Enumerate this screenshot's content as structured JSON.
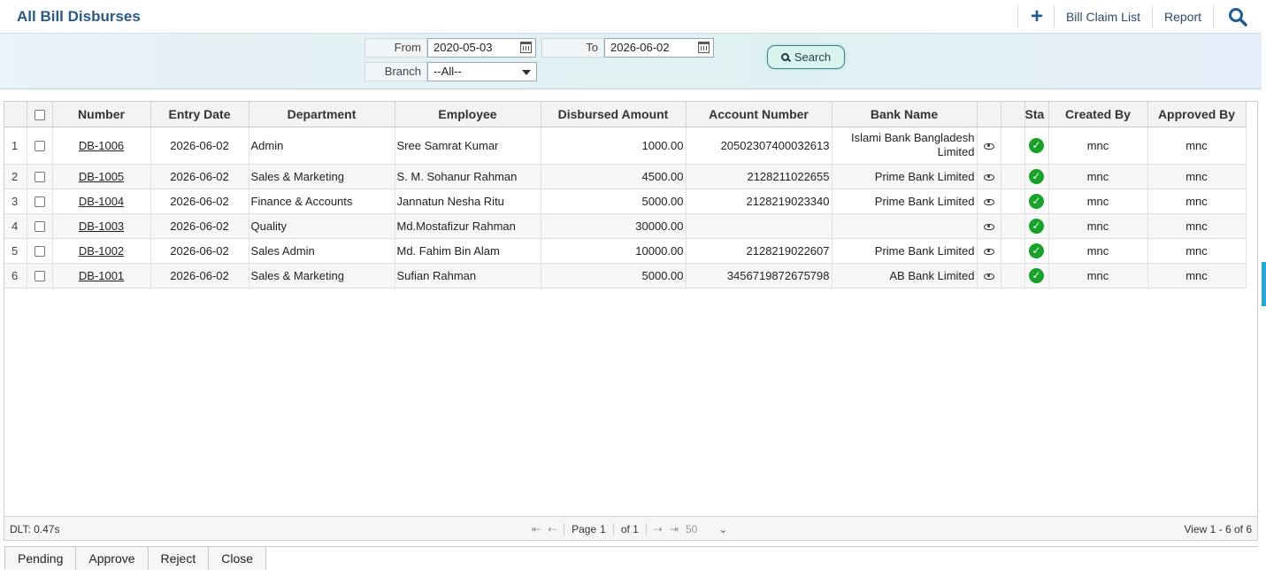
{
  "header": {
    "title": "All Bill Disburses",
    "actions": {
      "add_icon": "+",
      "bill_claim_list": "Bill Claim List",
      "report": "Report",
      "search_icon": "search-icon"
    }
  },
  "filter": {
    "from_label": "From",
    "from_value": "2020-05-03",
    "to_label": "To",
    "to_value": "2026-06-02",
    "branch_label": "Branch",
    "branch_value": "--All--",
    "search_label": "Search"
  },
  "table": {
    "columns": [
      "",
      "",
      "Number",
      "Entry Date",
      "Department",
      "Employee",
      "Disbursed Amount",
      "Account Number",
      "Bank Name",
      "",
      "",
      "Sta",
      "Created By",
      "Approved By"
    ],
    "rows": [
      {
        "idx": "1",
        "number": "DB-1006",
        "date": "2026-06-02",
        "department": "Admin",
        "employee": "Sree Samrat Kumar",
        "amount": "1000.00",
        "account": "20502307400032613",
        "bank": "Islami Bank Bangladesh Limited",
        "created_by": "mnc",
        "approved_by": "mnc"
      },
      {
        "idx": "2",
        "number": "DB-1005",
        "date": "2026-06-02",
        "department": "Sales & Marketing",
        "employee": "S. M. Sohanur Rahman",
        "amount": "4500.00",
        "account": "2128211022655",
        "bank": "Prime Bank Limited",
        "created_by": "mnc",
        "approved_by": "mnc"
      },
      {
        "idx": "3",
        "number": "DB-1004",
        "date": "2026-06-02",
        "department": "Finance & Accounts",
        "employee": "Jannatun Nesha Ritu",
        "amount": "5000.00",
        "account": "2128219023340",
        "bank": "Prime Bank Limited",
        "created_by": "mnc",
        "approved_by": "mnc"
      },
      {
        "idx": "4",
        "number": "DB-1003",
        "date": "2026-06-02",
        "department": "Quality",
        "employee": "Md.Mostafizur Rahman",
        "amount": "30000.00",
        "account": "",
        "bank": "",
        "created_by": "mnc",
        "approved_by": "mnc"
      },
      {
        "idx": "5",
        "number": "DB-1002",
        "date": "2026-06-02",
        "department": "Sales Admin",
        "employee": "Md. Fahim Bin Alam",
        "amount": "10000.00",
        "account": "2128219022607",
        "bank": "Prime Bank Limited",
        "created_by": "mnc",
        "approved_by": "mnc"
      },
      {
        "idx": "6",
        "number": "DB-1001",
        "date": "2026-06-02",
        "department": "Sales & Marketing",
        "employee": "Sufian Rahman",
        "amount": "5000.00",
        "account": "3456719872675798",
        "bank": "AB Bank Limited",
        "created_by": "mnc",
        "approved_by": "mnc"
      }
    ]
  },
  "pager": {
    "dlt": "DLT: 0.47s",
    "page_label": "Page",
    "page_value": "1",
    "of_label": "of 1",
    "page_size": "50",
    "view_info": "View 1 - 6 of 6"
  },
  "bottom": {
    "pending": "Pending",
    "approve": "Approve",
    "reject": "Reject",
    "close": "Close"
  },
  "colors": {
    "title": "#2a5a86",
    "status_ok": "#17a22a",
    "scroll_accent": "#2aa6d4"
  }
}
